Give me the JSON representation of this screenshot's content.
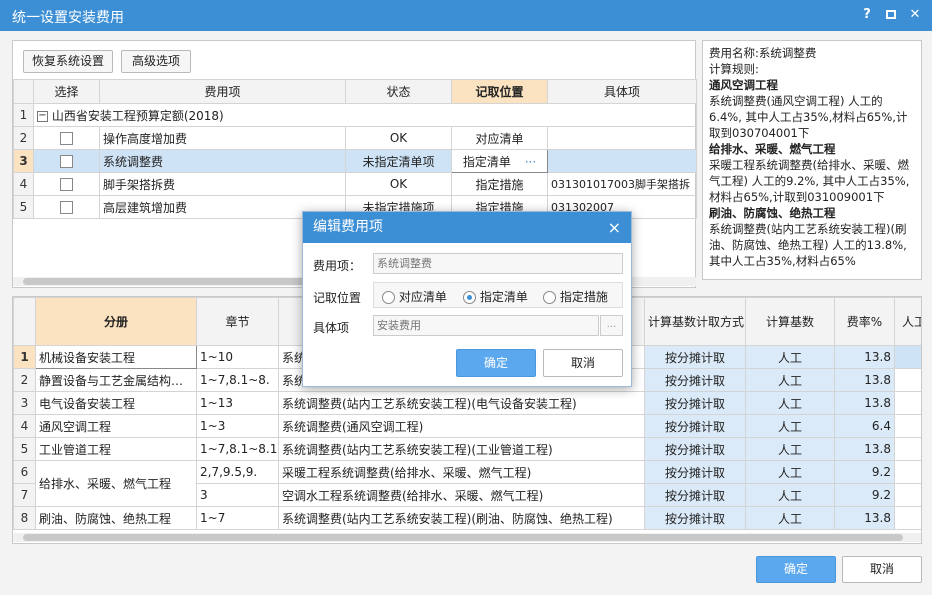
{
  "window": {
    "title": "统一设置安装费用",
    "help_icon": "?",
    "min_icon": "minimize-icon",
    "max_icon": "maximize-icon",
    "close_icon": "close-icon"
  },
  "toolbar": {
    "restore": "恢复系统设置",
    "advanced": "高级选项"
  },
  "top_table": {
    "headers": [
      "选择",
      "费用项",
      "状态",
      "记取位置",
      "具体项"
    ],
    "root": {
      "num": "1",
      "label": "山西省安装工程预算定额(2018)",
      "expand": "−"
    },
    "rows": [
      {
        "num": "2",
        "name": "操作高度增加费",
        "status": "OK",
        "pos": "对应清单",
        "item": ""
      },
      {
        "num": "3",
        "name": "系统调整费",
        "status": "未指定清单项",
        "pos": "指定清单",
        "item": "",
        "more": "···"
      },
      {
        "num": "4",
        "name": "脚手架搭拆费",
        "status": "OK",
        "pos": "指定措施",
        "item": "031301017003脚手架搭拆"
      },
      {
        "num": "5",
        "name": "高层建筑增加费",
        "status": "未指定措施项",
        "pos": "指定措施",
        "item": "031302007"
      }
    ]
  },
  "note": {
    "lines": [
      {
        "b": false,
        "t": "费用名称:系统调整费"
      },
      {
        "b": false,
        "t": "计算规则:"
      },
      {
        "b": true,
        "t": "通风空调工程"
      },
      {
        "b": false,
        "t": "系统调整费(通风空调工程) 人工的6.4%, 其中人工占35%,材料占65%,计取到030704001下"
      },
      {
        "b": true,
        "t": "给排水、采暖、燃气工程"
      },
      {
        "b": false,
        "t": "采暖工程系统调整费(给排水、采暖、燃气工程) 人工的9.2%, 其中人工占35%,材料占65%,计取到031009001下"
      },
      {
        "b": true,
        "t": "刷油、防腐蚀、绝热工程"
      },
      {
        "b": false,
        "t": "系统调整费(站内工艺系统安装工程)(刷油、防腐蚀、绝热工程) 人工的13.8%,其中人工占35%,材料占65%"
      }
    ]
  },
  "bottom_table": {
    "headers": [
      "分册",
      "章节",
      "",
      "计算基数计取方式",
      "计算基数",
      "费率%",
      "人工"
    ],
    "rows": [
      {
        "num": "1",
        "book": "机械设备安装工程",
        "ch": "1~10",
        "item": "系统",
        "mode": "按分摊计取",
        "base": "人工",
        "rate": "13.8"
      },
      {
        "num": "2",
        "book": "静置设备与工艺金属结构…",
        "ch": "1~7,8.1~8.",
        "item": "系统",
        "mode": "按分摊计取",
        "base": "人工",
        "rate": "13.8"
      },
      {
        "num": "3",
        "book": "电气设备安装工程",
        "ch": "1~13",
        "item": "系统调整费(站内工艺系统安装工程)(电气设备安装工程)",
        "mode": "按分摊计取",
        "base": "人工",
        "rate": "13.8"
      },
      {
        "num": "4",
        "book": "通风空调工程",
        "ch": "1~3",
        "item": "系统调整费(通风空调工程)",
        "mode": "按分摊计取",
        "base": "人工",
        "rate": "6.4"
      },
      {
        "num": "5",
        "book": "工业管道工程",
        "ch": "1~7,8.1~8.16",
        "item": "系统调整费(站内工艺系统安装工程)(工业管道工程)",
        "mode": "按分摊计取",
        "base": "人工",
        "rate": "13.8"
      },
      {
        "num": "6",
        "book": "给排水、采暖、燃气工程",
        "ch": "2,7,9.5,9.",
        "item": "采暖工程系统调整费(给排水、采暖、燃气工程)",
        "mode": "按分摊计取",
        "base": "人工",
        "rate": "9.2"
      },
      {
        "num": "7",
        "book": "",
        "ch": "3",
        "item": "空调水工程系统调整费(给排水、采暖、燃气工程)",
        "mode": "按分摊计取",
        "base": "人工",
        "rate": "9.2"
      },
      {
        "num": "8",
        "book": "刷油、防腐蚀、绝热工程",
        "ch": "1~7",
        "item": "系统调整费(站内工艺系统安装工程)(刷油、防腐蚀、绝热工程)",
        "mode": "按分摊计取",
        "base": "人工",
        "rate": "13.8"
      }
    ]
  },
  "modal": {
    "title": "编辑费用项",
    "close_icon": "×",
    "name_label": "费用项：",
    "name_placeholder": "系统调整费",
    "pos_label": "记取位置",
    "opts": [
      "对应清单",
      "指定清单",
      "指定措施"
    ],
    "item_label": "具体项",
    "item_placeholder": "安装费用",
    "browse": "...",
    "ok": "确定",
    "cancel": "取消"
  },
  "footer": {
    "ok": "确定",
    "cancel": "取消"
  }
}
